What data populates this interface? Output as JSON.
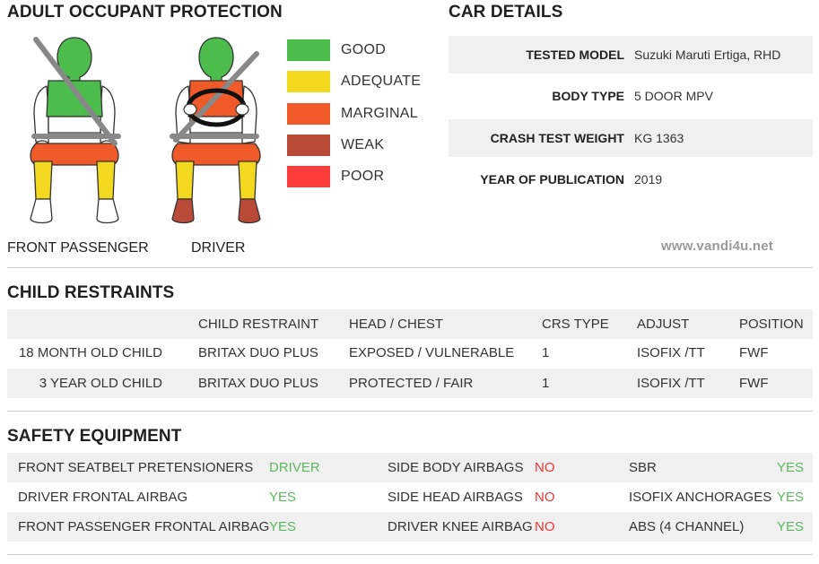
{
  "adult_occupant": {
    "title": "ADULT OCCUPANT PROTECTION",
    "front_passenger_label": "FRONT PASSENGER",
    "driver_label": "DRIVER",
    "legend": [
      {
        "label": "GOOD",
        "color": "#4cbd4c"
      },
      {
        "label": "ADEQUATE",
        "color": "#f2d81e"
      },
      {
        "label": "MARGINAL",
        "color": "#f05a28"
      },
      {
        "label": "WEAK",
        "color": "#b84a37"
      },
      {
        "label": "POOR",
        "color": "#ff3b3b"
      }
    ]
  },
  "car_details": {
    "title": "CAR DETAILS",
    "rows": [
      {
        "key": "TESTED MODEL",
        "value": "Suzuki Maruti Ertiga, RHD"
      },
      {
        "key": "BODY TYPE",
        "value": "5 DOOR MPV"
      },
      {
        "key": "CRASH TEST WEIGHT",
        "value": "KG 1363"
      },
      {
        "key": "YEAR OF PUBLICATION",
        "value": "2019"
      }
    ]
  },
  "watermark": "www.vandi4u.net",
  "child_restraints": {
    "title": "CHILD RESTRAINTS",
    "headers": [
      "",
      "CHILD RESTRAINT",
      "HEAD / CHEST",
      "CRS TYPE",
      "ADJUST",
      "POSITION"
    ],
    "rows": [
      [
        "18 MONTH OLD CHILD",
        "BRITAX DUO PLUS",
        "EXPOSED / VULNERABLE",
        "1",
        "ISOFIX /TT",
        "FWF"
      ],
      [
        "3 YEAR OLD CHILD",
        "BRITAX DUO PLUS",
        "PROTECTED / FAIR",
        "1",
        "ISOFIX /TT",
        "FWF"
      ]
    ]
  },
  "safety_equipment": {
    "title": "SAFETY EQUIPMENT",
    "rows": [
      [
        {
          "k": "FRONT SEATBELT PRETENSIONERS",
          "v": "DRIVER"
        },
        {
          "k": "SIDE BODY AIRBAGS",
          "v": "NO"
        },
        {
          "k": "SBR",
          "v": "YES"
        }
      ],
      [
        {
          "k": "DRIVER FRONTAL AIRBAG",
          "v": "YES"
        },
        {
          "k": "SIDE HEAD AIRBAGS",
          "v": "NO"
        },
        {
          "k": "ISOFIX ANCHORAGES",
          "v": "YES"
        }
      ],
      [
        {
          "k": "FRONT PASSENGER FRONTAL AIRBAG",
          "v": "YES"
        },
        {
          "k": "DRIVER KNEE AIRBAG",
          "v": "NO"
        },
        {
          "k": "ABS (4 CHANNEL)",
          "v": "YES"
        }
      ]
    ],
    "colors": {
      "yes": "#5cb85c",
      "no": "#e53935"
    }
  }
}
